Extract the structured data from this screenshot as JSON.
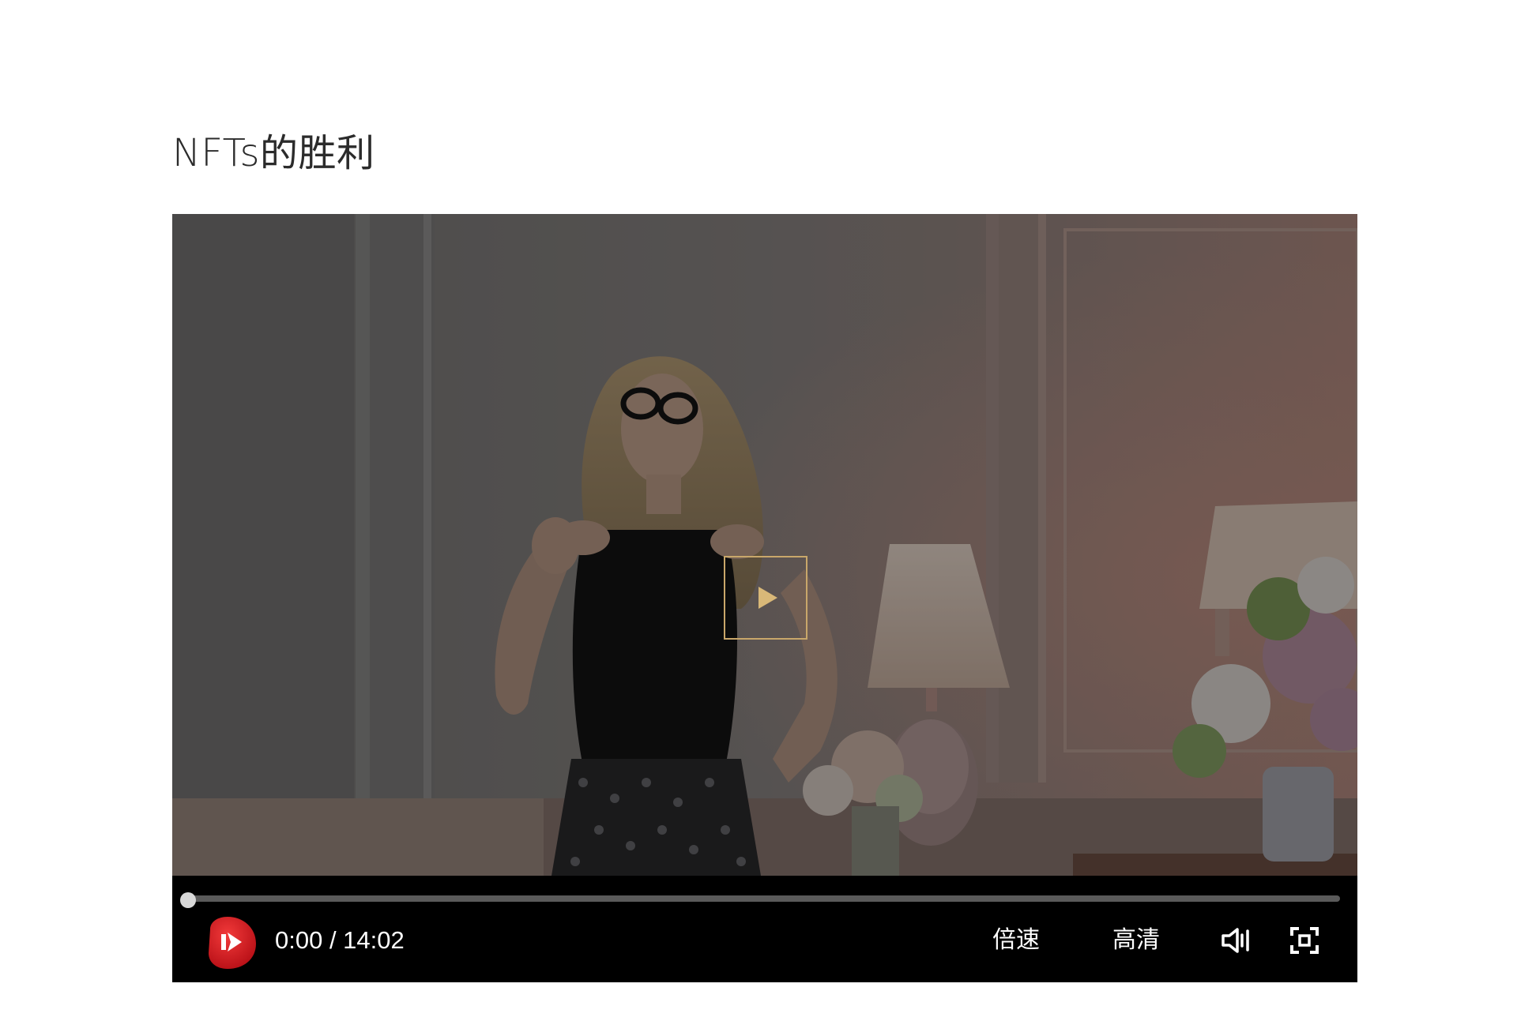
{
  "page": {
    "title": "NFTs的胜利"
  },
  "player": {
    "state": "paused",
    "time_display": "0:00 / 14:02",
    "progress_fraction": 0,
    "speed_label": "倍速",
    "quality_label": "高清",
    "icons": {
      "center_play": "play-icon",
      "play": "play-button-icon",
      "volume": "volume-icon",
      "fullscreen": "fullscreen-icon"
    },
    "colors": {
      "accent_gold": "#c9a76a",
      "play_red": "#d9181f",
      "controls_bg": "#000000"
    }
  }
}
